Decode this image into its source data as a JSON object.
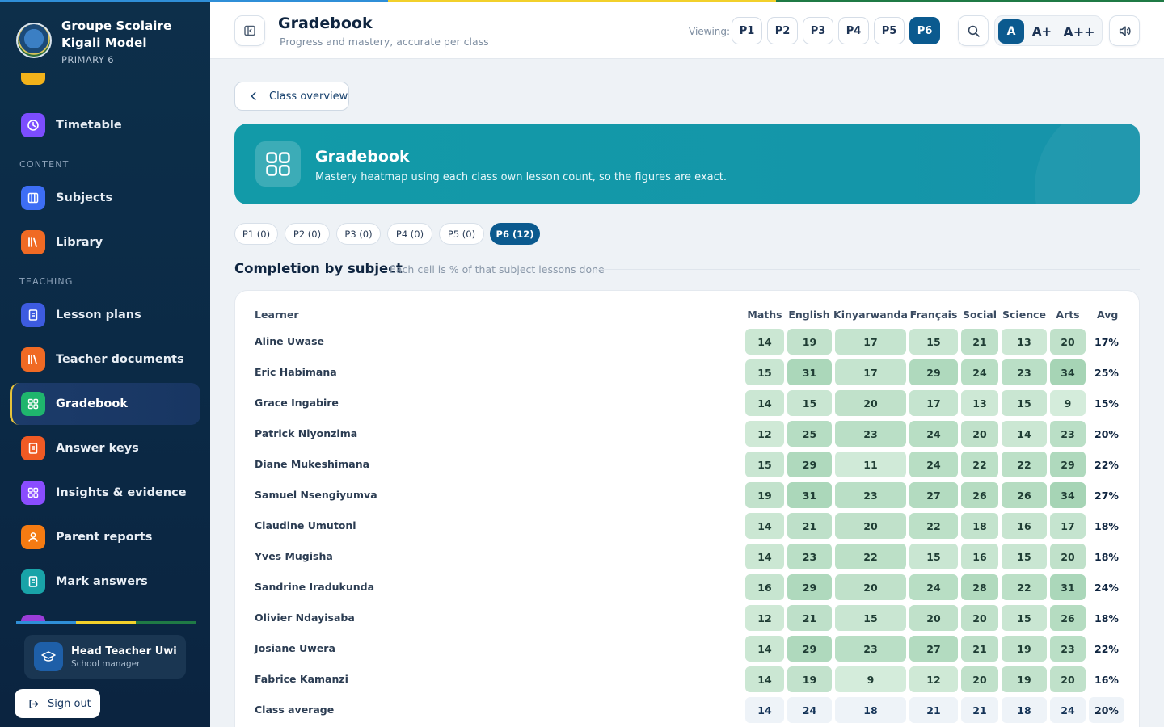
{
  "app": {
    "school_name_line1": "Groupe Scolaire",
    "school_name_line2": "Kigali Model",
    "level": "PRIMARY 6"
  },
  "sidebar": {
    "sections": {
      "content": "CONTENT",
      "teaching": "TEACHING"
    },
    "items": [
      {
        "label": "Timetable",
        "icon": "clock-icon",
        "color": "#7c4dff"
      },
      {
        "label": "Subjects",
        "icon": "columns-icon",
        "color": "#3d6ef5"
      },
      {
        "label": "Library",
        "icon": "books-icon",
        "color": "#f06a24"
      },
      {
        "label": "Lesson plans",
        "icon": "document-icon",
        "color": "#3d5be0"
      },
      {
        "label": "Teacher documents",
        "icon": "books-icon",
        "color": "#f06a24"
      },
      {
        "label": "Gradebook",
        "icon": "grid-icon",
        "color": "#1fb56d"
      },
      {
        "label": "Answer keys",
        "icon": "document-icon",
        "color": "#f05a24"
      },
      {
        "label": "Insights & evidence",
        "icon": "grid-icon",
        "color": "#8a4dff"
      },
      {
        "label": "Parent reports",
        "icon": "person-icon",
        "color": "#f57b12"
      },
      {
        "label": "Mark answers",
        "icon": "document-icon",
        "color": "#19a3a8"
      }
    ],
    "user": {
      "name": "Head Teacher Uwi...",
      "role": "School manager"
    },
    "sign_out": "Sign out"
  },
  "header": {
    "title": "Gradebook",
    "subtitle": "Progress and mastery, accurate per class",
    "viewing_label": "Viewing:",
    "grades": [
      "P1",
      "P2",
      "P3",
      "P4",
      "P5",
      "P6"
    ],
    "selected_grade": "P6",
    "font_sizes": [
      "A",
      "A+",
      "A++"
    ],
    "selected_font_size": "A"
  },
  "back_button": "Class overview",
  "hero": {
    "title": "Gradebook",
    "subtitle": "Mastery heatmap using each class own lesson count, so the figures are exact."
  },
  "class_pills": [
    "P1 (0)",
    "P2 (0)",
    "P3 (0)",
    "P4 (0)",
    "P5 (0)",
    "P6 (12)"
  ],
  "selected_pill": "P6 (12)",
  "section": {
    "title": "Completion by subject",
    "subtitle": "Each cell is % of that subject lessons done"
  },
  "table": {
    "learner_header": "Learner",
    "subjects": [
      "Maths",
      "English",
      "Kinyarwanda",
      "Français",
      "Social",
      "Science",
      "Arts"
    ],
    "avg_header": "Avg",
    "rows": [
      {
        "name": "Aline Uwase",
        "values": [
          14,
          19,
          17,
          15,
          21,
          13,
          20
        ],
        "avg": "17%"
      },
      {
        "name": "Eric Habimana",
        "values": [
          15,
          31,
          17,
          29,
          24,
          23,
          34
        ],
        "avg": "25%"
      },
      {
        "name": "Grace Ingabire",
        "values": [
          14,
          15,
          20,
          17,
          13,
          15,
          9
        ],
        "avg": "15%"
      },
      {
        "name": "Patrick Niyonzima",
        "values": [
          12,
          25,
          23,
          24,
          20,
          14,
          23
        ],
        "avg": "20%"
      },
      {
        "name": "Diane Mukeshimana",
        "values": [
          15,
          29,
          11,
          24,
          22,
          22,
          29
        ],
        "avg": "22%"
      },
      {
        "name": "Samuel Nsengiyumva",
        "values": [
          19,
          31,
          23,
          27,
          26,
          26,
          34
        ],
        "avg": "27%"
      },
      {
        "name": "Claudine Umutoni",
        "values": [
          14,
          21,
          20,
          22,
          18,
          16,
          17
        ],
        "avg": "18%"
      },
      {
        "name": "Yves Mugisha",
        "values": [
          14,
          23,
          22,
          15,
          16,
          15,
          20
        ],
        "avg": "18%"
      },
      {
        "name": "Sandrine Iradukunda",
        "values": [
          16,
          29,
          20,
          24,
          28,
          22,
          31
        ],
        "avg": "24%"
      },
      {
        "name": "Olivier Ndayisaba",
        "values": [
          12,
          21,
          15,
          20,
          20,
          15,
          26
        ],
        "avg": "18%"
      },
      {
        "name": "Josiane Uwera",
        "values": [
          14,
          29,
          23,
          27,
          21,
          19,
          23
        ],
        "avg": "22%"
      },
      {
        "name": "Fabrice Kamanzi",
        "values": [
          14,
          19,
          9,
          12,
          20,
          19,
          20
        ],
        "avg": "16%"
      }
    ],
    "class_average": {
      "name": "Class average",
      "values": [
        14,
        24,
        18,
        21,
        21,
        18,
        24
      ],
      "avg": "20%"
    }
  },
  "colors": {
    "accent": "#0b5a8f",
    "hero": "#1496a9",
    "flag_blue": "#2f8fd8",
    "flag_yellow": "#f2d02b",
    "flag_green": "#1f7a45"
  }
}
